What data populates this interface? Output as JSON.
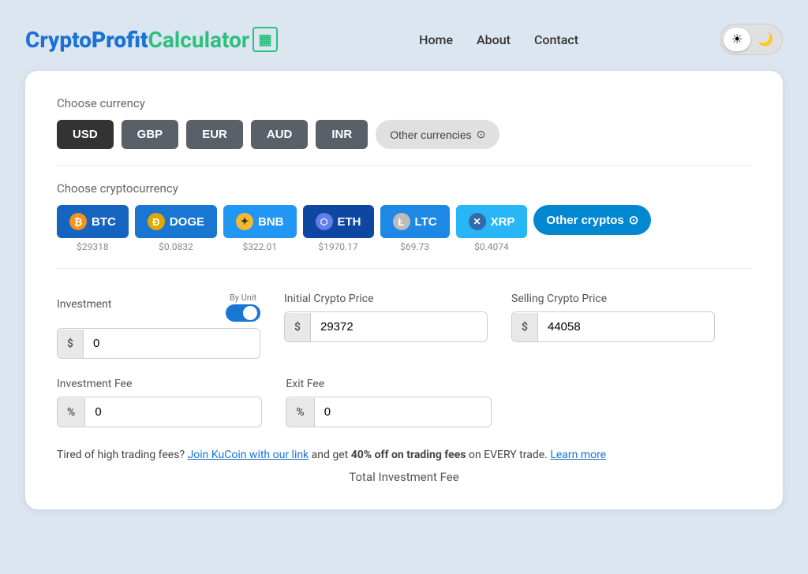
{
  "header": {
    "logo": {
      "crypto": "Crypto",
      "profit": "Profit",
      "calculator": "Calculator",
      "icon": "▦"
    },
    "nav": {
      "home": "Home",
      "about": "About",
      "contact": "Contact"
    },
    "theme": {
      "light_icon": "☀",
      "dark_icon": "🌙"
    }
  },
  "currency_section": {
    "label": "Choose currency",
    "buttons": [
      "USD",
      "GBP",
      "EUR",
      "AUD",
      "INR"
    ],
    "other_label": "Other currencies",
    "other_icon": "⊙"
  },
  "crypto_section": {
    "label": "Choose cryptocurrency",
    "cryptos": [
      {
        "id": "btc",
        "symbol": "BTC",
        "price": "$29318",
        "icon": "₿",
        "icon_class": "btc"
      },
      {
        "id": "doge",
        "symbol": "DOGE",
        "price": "$0.0832",
        "icon": "Ð",
        "icon_class": "doge"
      },
      {
        "id": "bnb",
        "symbol": "BNB",
        "price": "$322.01",
        "icon": "✦",
        "icon_class": "bnb"
      },
      {
        "id": "eth",
        "symbol": "ETH",
        "price": "$1970.17",
        "icon": "⬡",
        "icon_class": "eth"
      },
      {
        "id": "ltc",
        "symbol": "LTC",
        "price": "$69.73",
        "icon": "Ł",
        "icon_class": "ltc"
      },
      {
        "id": "xrp",
        "symbol": "XRP",
        "price": "$0.4074",
        "icon": "✕",
        "icon_class": "xrp"
      }
    ],
    "other_label": "Other cryptos",
    "other_icon": "⊙"
  },
  "form": {
    "investment": {
      "label": "Investment",
      "toggle_label": "By Unit",
      "prefix": "$",
      "value": "0",
      "placeholder": "0"
    },
    "initial_price": {
      "label": "Initial Crypto Price",
      "prefix": "$",
      "value": "29372",
      "placeholder": "29372"
    },
    "selling_price": {
      "label": "Selling Crypto Price",
      "prefix": "$",
      "value": "44058",
      "placeholder": "44058"
    },
    "investment_fee": {
      "label": "Investment Fee",
      "prefix": "%",
      "value": "0",
      "placeholder": "0"
    },
    "exit_fee": {
      "label": "Exit Fee",
      "prefix": "%",
      "value": "0",
      "placeholder": "0"
    }
  },
  "promo": {
    "text1": "Tired of high trading fees?",
    "link1": "Join KuCoin with our link",
    "text2": "and get",
    "bold": "40% off on trading fees",
    "text3": "on EVERY trade.",
    "link2": "Learn more"
  },
  "total": {
    "label": "Total Investment Fee"
  }
}
